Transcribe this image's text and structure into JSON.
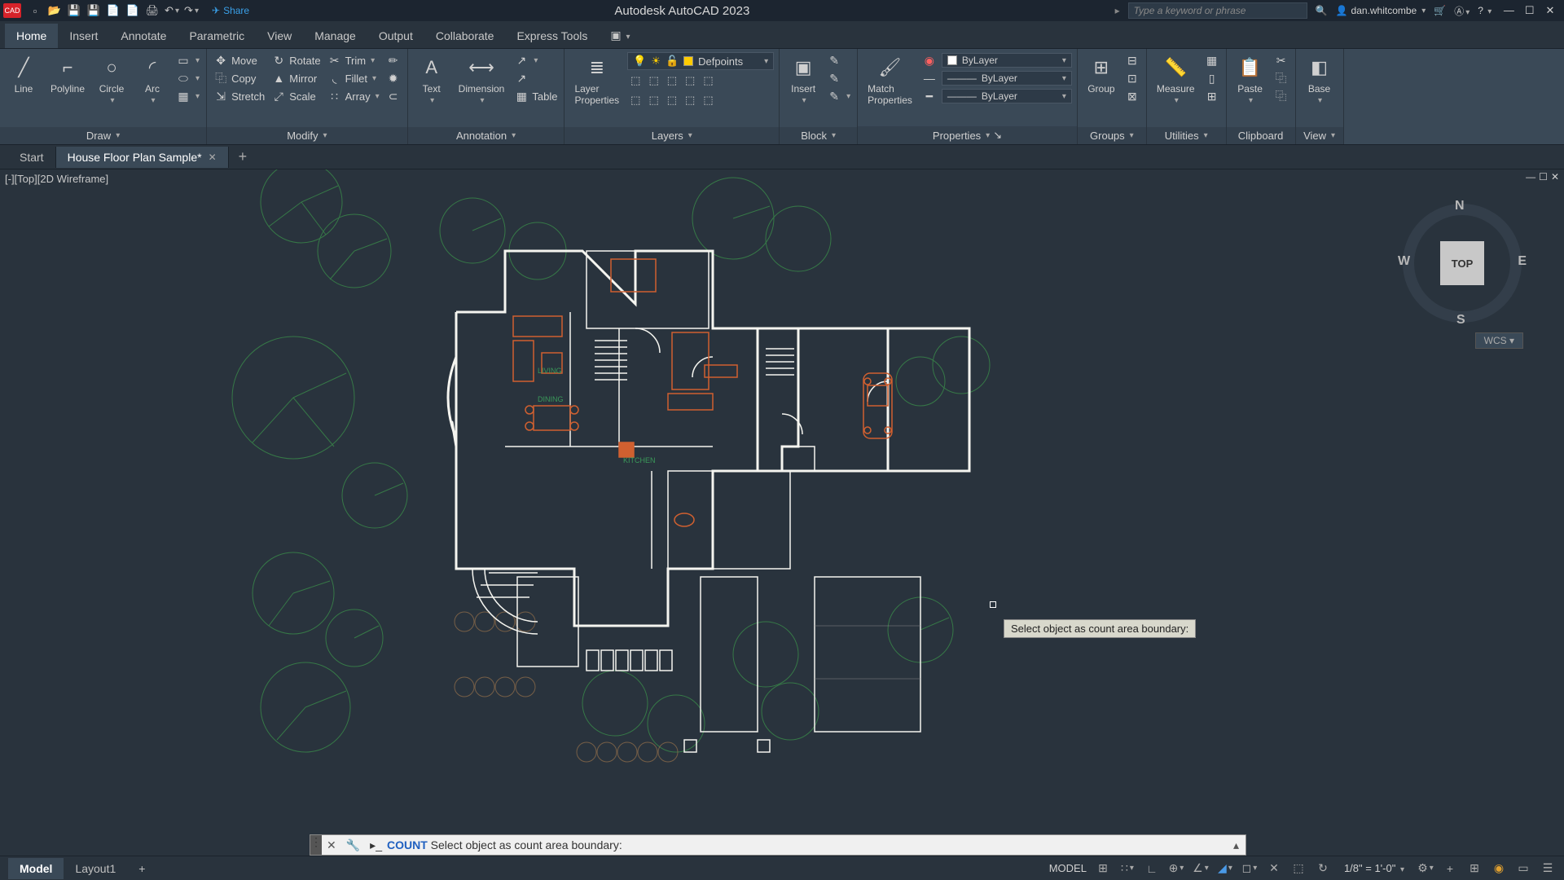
{
  "app": {
    "name": "CAD",
    "title": "Autodesk AutoCAD 2023",
    "share": "Share",
    "search_placeholder": "Type a keyword or phrase",
    "user": "dan.whitcombe"
  },
  "menu": {
    "tabs": [
      "Home",
      "Insert",
      "Annotate",
      "Parametric",
      "View",
      "Manage",
      "Output",
      "Collaborate",
      "Express Tools"
    ]
  },
  "ribbon": {
    "draw": {
      "label": "Draw",
      "line": "Line",
      "polyline": "Polyline",
      "circle": "Circle",
      "arc": "Arc"
    },
    "modify": {
      "label": "Modify",
      "move": "Move",
      "rotate": "Rotate",
      "trim": "Trim",
      "copy": "Copy",
      "mirror": "Mirror",
      "fillet": "Fillet",
      "stretch": "Stretch",
      "scale": "Scale",
      "array": "Array"
    },
    "annotation": {
      "label": "Annotation",
      "text": "Text",
      "dimension": "Dimension",
      "table": "Table"
    },
    "layers": {
      "label": "Layers",
      "properties": "Layer\nProperties",
      "current": "Defpoints"
    },
    "block": {
      "label": "Block",
      "insert": "Insert"
    },
    "properties": {
      "label": "Properties",
      "match": "Match\nProperties",
      "bylayer1": "ByLayer",
      "bylayer2": "ByLayer",
      "bylayer3": "ByLayer"
    },
    "groups": {
      "label": "Groups",
      "group": "Group"
    },
    "utilities": {
      "label": "Utilities",
      "measure": "Measure"
    },
    "clipboard": {
      "label": "Clipboard",
      "paste": "Paste"
    },
    "view": {
      "label": "View",
      "base": "Base"
    }
  },
  "files": {
    "start": "Start",
    "active": "House Floor Plan Sample*"
  },
  "viewport": {
    "label": "[-][Top][2D Wireframe]",
    "viewcube_top": "TOP",
    "n": "N",
    "s": "S",
    "e": "E",
    "w": "W",
    "wcs": "WCS"
  },
  "rooms": {
    "living": "LIVING",
    "dining": "DINING",
    "kitchen": "KITCHEN"
  },
  "tooltip": "Select object as count area boundary:",
  "command": {
    "name": "COUNT",
    "prompt": "Select object as count area boundary:"
  },
  "layouts": {
    "model": "Model",
    "layout1": "Layout1"
  },
  "status": {
    "model": "MODEL",
    "scale": "1/8\" = 1'-0\""
  }
}
